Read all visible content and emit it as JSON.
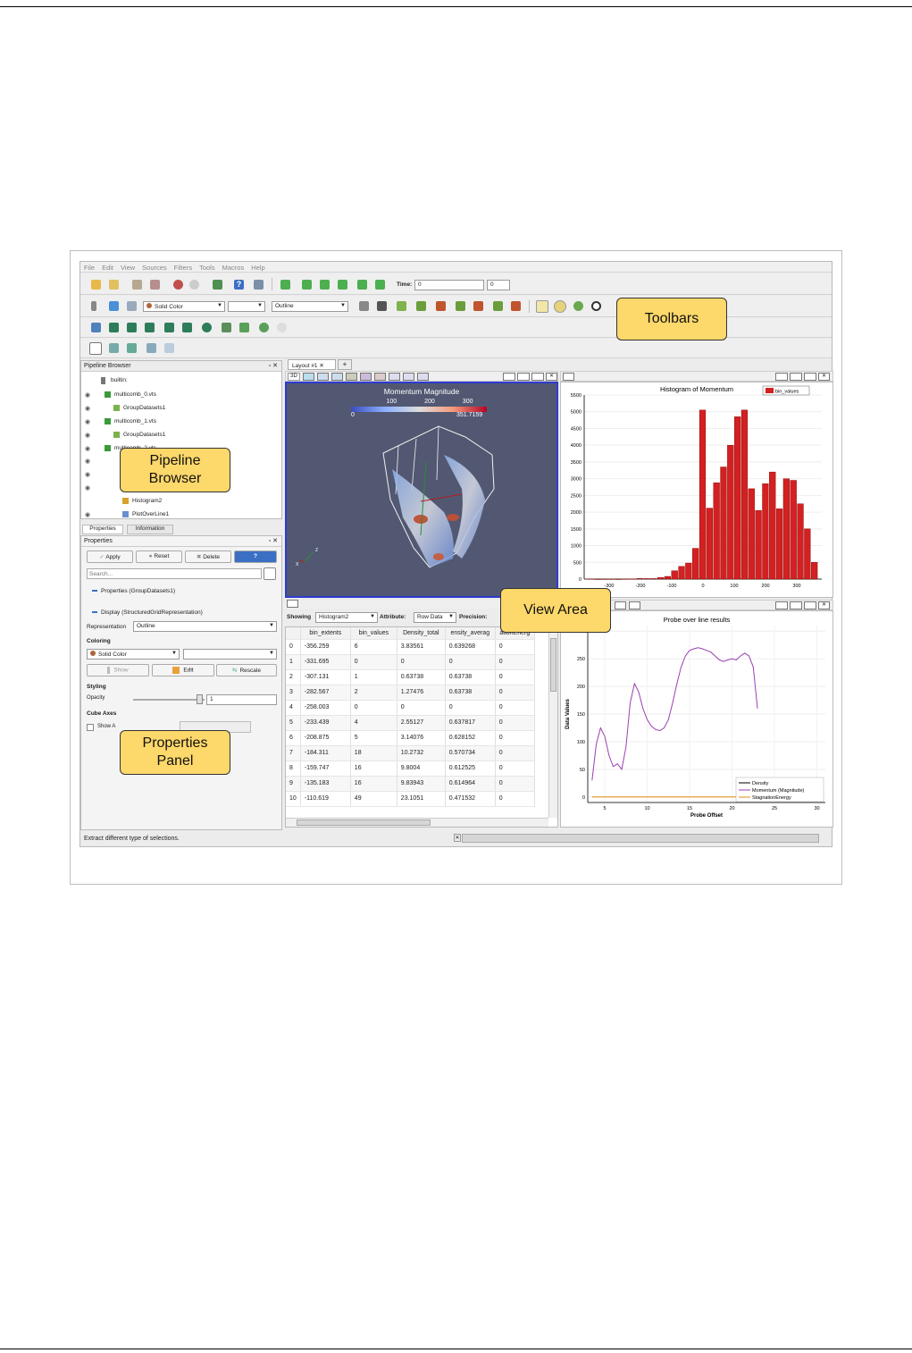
{
  "menu": [
    "File",
    "Edit",
    "View",
    "Sources",
    "Filters",
    "Tools",
    "Macros",
    "Help"
  ],
  "toolbar": {
    "time_label": "Time:",
    "time_value": "0",
    "time_index": "0",
    "color_combo": "Solid Color",
    "repr_combo": "Outline"
  },
  "callouts": {
    "toolbars": "Toolbars",
    "pipeline_line1": "Pipeline",
    "pipeline_line2": "Browser",
    "view_area": "View Area",
    "properties_line1": "Properties",
    "properties_line2": "Panel"
  },
  "pipeline": {
    "title": "Pipeline Browser",
    "root": "builtin:",
    "items": [
      "multicomb_0.vts",
      "GroupDatasets1",
      "multicomb_1.vts",
      "GroupDatasets1",
      "multicomb_2.vts",
      "Histogram2",
      "PlotOverLine1"
    ]
  },
  "properties": {
    "tabs": [
      "Properties",
      "Information"
    ],
    "title": "Properties",
    "apply": "Apply",
    "reset": "Reset",
    "delete": "Delete",
    "help": "?",
    "search_placeholder": "Search...",
    "section1": "Properties (GroupDatasets1)",
    "section2": "Display (StructuredGridRepresentation)",
    "representation_label": "Representation",
    "representation_value": "Outline",
    "coloring_label": "Coloring",
    "coloring_value": "Solid Color",
    "show": "Show",
    "edit": "Edit",
    "rescale": "Rescale",
    "styling_label": "Styling",
    "opacity_label": "Opacity",
    "opacity_value": "1",
    "opacity_level": 1,
    "cube_axes_label": "Cube Axes",
    "show_axes": "Show A",
    "status": "Extract different type of selections."
  },
  "layout_tab": "Layout #1",
  "render_view": {
    "mode": "3D",
    "colorbar_title": "Momentum Magnitude",
    "colorbar_ticks": [
      "100",
      "200",
      "300"
    ],
    "colorbar_min": "0",
    "colorbar_max": "351.7159"
  },
  "spreadsheet": {
    "showing_label": "Showing",
    "showing_value": "Histogram2",
    "attribute_label": "Attribute:",
    "attribute_value": "Row Data",
    "precision_label": "Precision:",
    "columns": [
      "bin_extents",
      "bin_values",
      "Density_total",
      "ensity_averag",
      "ationEnerg"
    ],
    "rows": [
      [
        "0",
        "-356.259",
        "6",
        "3.83561",
        "0.639268",
        "0"
      ],
      [
        "1",
        "-331.695",
        "0",
        "0",
        "0",
        "0"
      ],
      [
        "2",
        "-307.131",
        "1",
        "0.63738",
        "0.63738",
        "0"
      ],
      [
        "3",
        "-282.567",
        "2",
        "1.27476",
        "0.63738",
        "0"
      ],
      [
        "4",
        "-258.003",
        "0",
        "0",
        "0",
        "0"
      ],
      [
        "5",
        "-233.439",
        "4",
        "2.55127",
        "0.637817",
        "0"
      ],
      [
        "6",
        "-208.875",
        "5",
        "3.14076",
        "0.628152",
        "0"
      ],
      [
        "7",
        "-184.311",
        "18",
        "10.2732",
        "0.570734",
        "0"
      ],
      [
        "8",
        "-159.747",
        "16",
        "9.8004",
        "0.612525",
        "0"
      ],
      [
        "9",
        "-135.183",
        "16",
        "9.83943",
        "0.614964",
        "0"
      ],
      [
        "10",
        "-110.619",
        "49",
        "23.1051",
        "0.471532",
        "0"
      ]
    ]
  },
  "chart_data": [
    {
      "type": "bar",
      "title": "Histogram of Momentum",
      "legend": [
        "bin_values"
      ],
      "legend_position": "top-right",
      "x": [
        -356,
        -332,
        -307,
        -283,
        -258,
        -233,
        -209,
        -184,
        -160,
        -135,
        -111,
        -86,
        -62,
        -37,
        -12,
        12,
        37,
        62,
        86,
        111,
        135,
        160,
        184,
        209,
        233,
        258,
        283,
        307,
        332
      ],
      "values": [
        6,
        0,
        1,
        2,
        0,
        4,
        5,
        18,
        16,
        16,
        49,
        80,
        250,
        380,
        480,
        920,
        5050,
        2120,
        2880,
        3350,
        4000,
        4850,
        5050,
        2700,
        2050,
        2850,
        3200,
        2100,
        3000,
        2950,
        2250,
        1500,
        500
      ],
      "xticks": [
        "-300",
        "-200",
        "-100",
        "0",
        "100",
        "200",
        "300"
      ],
      "yticks": [
        "0",
        "500",
        "1000",
        "1500",
        "2000",
        "2500",
        "3000",
        "3500",
        "4000",
        "4500",
        "5000",
        "5500"
      ],
      "xlim": [
        -380,
        380
      ],
      "ylim": [
        0,
        5500
      ],
      "color": "#d42020"
    },
    {
      "type": "line",
      "title": "Probe over line results",
      "xlabel": "Probe Offset",
      "ylabel": "Data Values",
      "xticks": [
        "5",
        "10",
        "15",
        "20",
        "25",
        "30"
      ],
      "yticks": [
        "0",
        "50",
        "100",
        "150",
        "200",
        "250",
        "300"
      ],
      "xlim": [
        3,
        31
      ],
      "ylim": [
        -10,
        310
      ],
      "series": [
        {
          "name": "Density",
          "color": "#000000",
          "x": [],
          "y": []
        },
        {
          "name": "Momentum (Magnitude)",
          "color": "#9b3fb0",
          "x": [
            3.5,
            4,
            4.5,
            5,
            5.5,
            6,
            6.5,
            7,
            7.5,
            8,
            8.5,
            9,
            9.5,
            10,
            10.5,
            11,
            11.5,
            12,
            12.5,
            13,
            13.5,
            14,
            14.5,
            15,
            15.5,
            16,
            16.5,
            17,
            17.5,
            18,
            18.5,
            19,
            19.5,
            20,
            20.5,
            21,
            21.5,
            22,
            22.5,
            23
          ],
          "y": [
            30,
            95,
            125,
            110,
            75,
            55,
            60,
            50,
            90,
            170,
            205,
            190,
            160,
            140,
            128,
            122,
            120,
            125,
            140,
            170,
            205,
            235,
            255,
            265,
            268,
            270,
            268,
            265,
            262,
            255,
            248,
            245,
            248,
            250,
            248,
            255,
            260,
            255,
            235,
            160
          ]
        },
        {
          "name": "StagnationEnergy",
          "color": "#e08a10",
          "x": [
            3.5,
            23
          ],
          "y": [
            0,
            0
          ]
        }
      ],
      "legend_position": "bottom-right"
    }
  ]
}
